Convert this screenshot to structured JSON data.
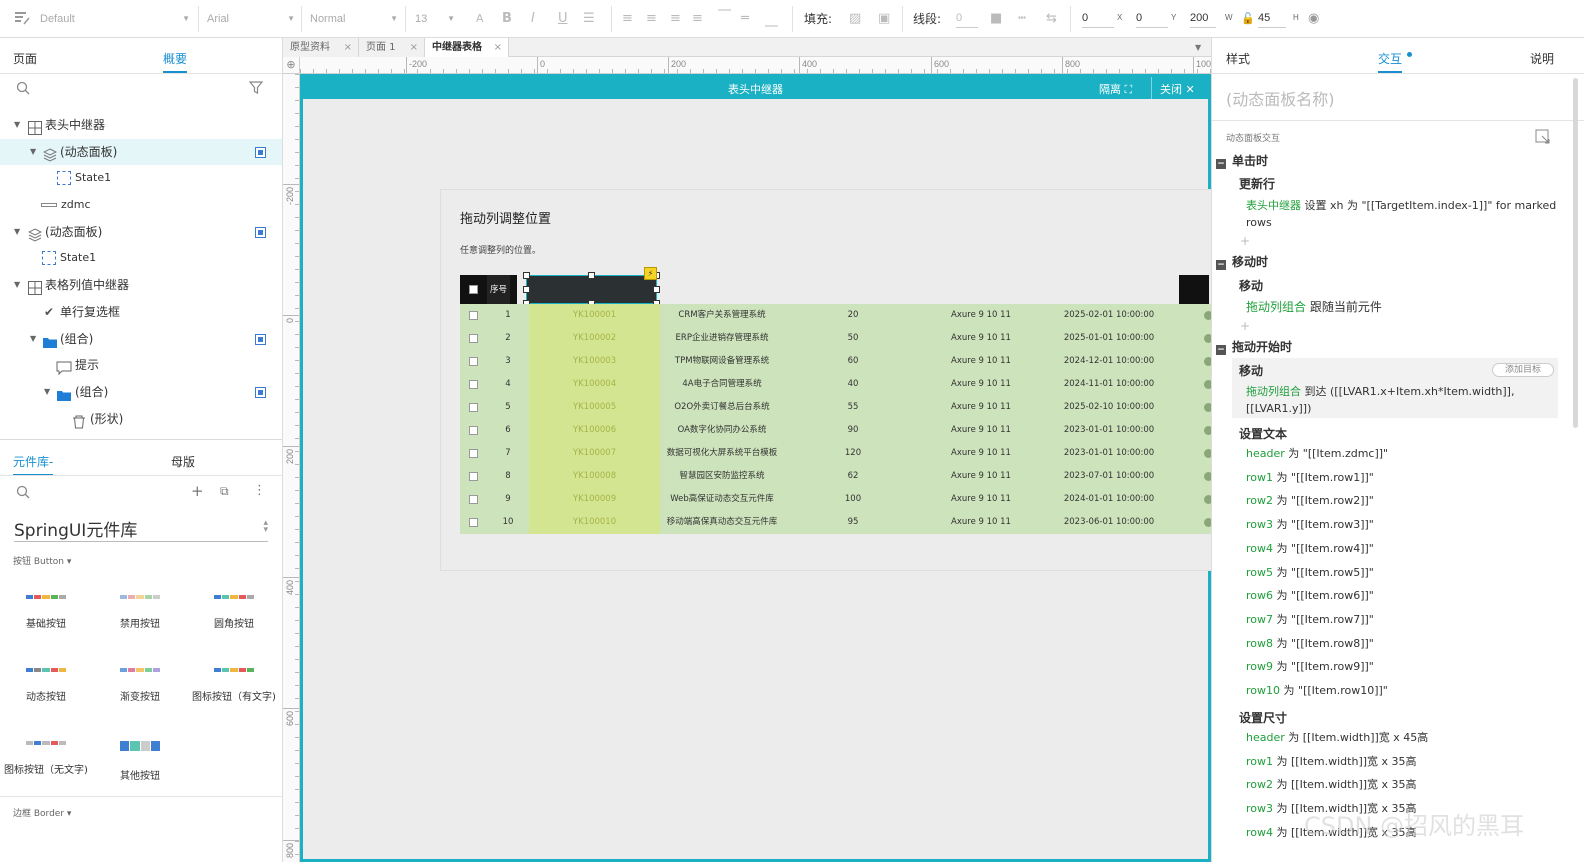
{
  "toolbar": {
    "style": "Default",
    "font": "Arial",
    "weight": "Normal",
    "size": "13",
    "fill_label": "填充:",
    "stroke_label": "线段:",
    "stroke_value": "0",
    "x": "0",
    "x_label": "X",
    "y": "0",
    "y_label": "Y",
    "w": "200",
    "w_label": "W",
    "h": "45",
    "h_label": "H"
  },
  "left_panel": {
    "tabs": [
      "页面",
      "概要"
    ],
    "tree": [
      {
        "label": "表头中继器"
      },
      {
        "label": "(动态面板)"
      },
      {
        "label": "State1"
      },
      {
        "label": "zdmc"
      },
      {
        "label": "(动态面板)"
      },
      {
        "label": "State1"
      },
      {
        "label": "表格列值中继器"
      },
      {
        "label": "单行复选框"
      },
      {
        "label": "(组合)"
      },
      {
        "label": "提示"
      },
      {
        "label": "(组合)"
      },
      {
        "label": "(形状)"
      }
    ],
    "lib_tabs": [
      "元件库-",
      "母版"
    ],
    "library_name": "SpringUI元件库",
    "section_button": "按钮 Button ▾",
    "components": [
      "基础按钮",
      "禁用按钮",
      "圆角按钮",
      "动态按钮",
      "渐变按钮",
      "图标按钮（有文字)",
      "图标按钮（无文字)",
      "其他按钮"
    ],
    "section_border": "边框 Border ▾"
  },
  "center": {
    "tabs": [
      "原型资料",
      "页面 1",
      "中继器表格"
    ],
    "ruler_h": [
      "-200",
      "0",
      "200",
      "400",
      "600",
      "800",
      "1000"
    ],
    "ruler_v": [
      "-200",
      "0",
      "200",
      "400",
      "600",
      "800"
    ],
    "panel_title": "表头中继器",
    "isolate_label": "隔离",
    "close_label": "关闭",
    "card_title": "拖动列调整位置",
    "card_subtitle": "任意调整列的位置。",
    "header_seq": "序号",
    "rows": [
      {
        "n": "1",
        "code": "YK100001",
        "name": "CRM客户关系管理系统",
        "qty": "20",
        "ver": "Axure 9 10 11",
        "date": "2025-02-01 10:00:00"
      },
      {
        "n": "2",
        "code": "YK100002",
        "name": "ERP企业进销存管理系统",
        "qty": "50",
        "ver": "Axure 9 10 11",
        "date": "2025-01-01 10:00:00"
      },
      {
        "n": "3",
        "code": "YK100003",
        "name": "TPM物联网设备管理系统",
        "qty": "60",
        "ver": "Axure 9 10 11",
        "date": "2024-12-01 10:00:00"
      },
      {
        "n": "4",
        "code": "YK100004",
        "name": "4A电子合同管理系统",
        "qty": "40",
        "ver": "Axure 9 10 11",
        "date": "2024-11-01 10:00:00"
      },
      {
        "n": "5",
        "code": "YK100005",
        "name": "O2O外卖订餐总后台系统",
        "qty": "55",
        "ver": "Axure 9 10 11",
        "date": "2025-02-10 10:00:00"
      },
      {
        "n": "6",
        "code": "YK100006",
        "name": "OA数字化协同办公系统",
        "qty": "90",
        "ver": "Axure 9 10 11",
        "date": "2023-01-01 10:00:00"
      },
      {
        "n": "7",
        "code": "YK100007",
        "name": "数据可视化大屏系统平台模板",
        "qty": "120",
        "ver": "Axure 9 10 11",
        "date": "2023-01-01 10:00:00"
      },
      {
        "n": "8",
        "code": "YK100008",
        "name": "智慧园区安防监控系统",
        "qty": "62",
        "ver": "Axure 9 10 11",
        "date": "2023-07-01 10:00:00"
      },
      {
        "n": "9",
        "code": "YK100009",
        "name": "Web高保证动态交互元件库",
        "qty": "100",
        "ver": "Axure 9 10 11",
        "date": "2024-01-01 10:00:00"
      },
      {
        "n": "10",
        "code": "YK100010",
        "name": "移动端高保真动态交互元件库",
        "qty": "95",
        "ver": "Axure 9 10 11",
        "date": "2023-06-01 10:00:00"
      }
    ]
  },
  "right_panel": {
    "tabs": [
      "样式",
      "交互",
      "说明"
    ],
    "panel_name_placeholder": "(动态面板名称)",
    "section_label": "动态面板交互",
    "events": {
      "click": "单击时",
      "click_action": "更新行",
      "click_target": "表头中继器",
      "click_text": " 设置 xh 为 \"[[TargetItem.index-1]]\" for marked",
      "click_text2": "rows",
      "move": "移动时",
      "move_action": "移动",
      "move_target": "拖动列组合",
      "move_text": " 跟随当前元件",
      "drag_start": "拖动开始时",
      "drag_action": "移动",
      "add_target": "添加目标",
      "drag_target": "拖动列组合",
      "drag_text": " 到达 ([[LVAR1.x+Item.xh*Item.width]],",
      "drag_text2": "[[LVAR1.y]])",
      "set_text": "设置文本",
      "set_text_items": [
        {
          "g": "header",
          "t": " 为 \"[[Item.zdmc]]\""
        },
        {
          "g": "row1",
          "t": " 为 \"[[Item.row1]]\""
        },
        {
          "g": "row2",
          "t": " 为 \"[[Item.row2]]\""
        },
        {
          "g": "row3",
          "t": " 为 \"[[Item.row3]]\""
        },
        {
          "g": "row4",
          "t": " 为 \"[[Item.row4]]\""
        },
        {
          "g": "row5",
          "t": " 为 \"[[Item.row5]]\""
        },
        {
          "g": "row6",
          "t": " 为 \"[[Item.row6]]\""
        },
        {
          "g": "row7",
          "t": " 为 \"[[Item.row7]]\""
        },
        {
          "g": "row8",
          "t": " 为 \"[[Item.row8]]\""
        },
        {
          "g": "row9",
          "t": " 为 \"[[Item.row9]]\""
        },
        {
          "g": "row10",
          "t": " 为 \"[[Item.row10]]\""
        }
      ],
      "set_size": "设置尺寸",
      "set_size_items": [
        {
          "g": "header",
          "t": " 为 [[Item.width]]宽 x 45高"
        },
        {
          "g": "row1",
          "t": " 为 [[Item.width]]宽 x 35高"
        },
        {
          "g": "row2",
          "t": " 为 [[Item.width]]宽 x 35高"
        },
        {
          "g": "row3",
          "t": " 为 [[Item.width]]宽 x 35高"
        },
        {
          "g": "row4",
          "t": " 为 [[Item.width]]宽 x 35高"
        }
      ]
    },
    "watermark": "CSDN @招风的黑耳"
  }
}
